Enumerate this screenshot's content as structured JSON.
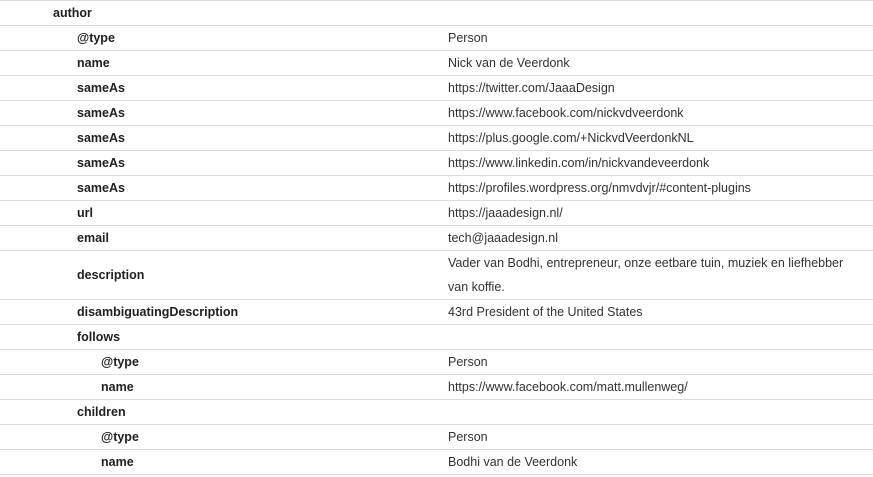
{
  "rows": [
    {
      "key": "author",
      "value": ""
    },
    {
      "key": "@type",
      "value": "Person"
    },
    {
      "key": "name",
      "value": "Nick van de Veerdonk"
    },
    {
      "key": "sameAs",
      "value": "https://twitter.com/JaaaDesign"
    },
    {
      "key": "sameAs",
      "value": "https://www.facebook.com/nickvdveerdonk"
    },
    {
      "key": "sameAs",
      "value": "https://plus.google.com/+NickvdVeerdonkNL"
    },
    {
      "key": "sameAs",
      "value": "https://www.linkedin.com/in/nickvandeveerdonk"
    },
    {
      "key": "sameAs",
      "value": "https://profiles.wordpress.org/nmvdvjr/#content-plugins"
    },
    {
      "key": "url",
      "value": "https://jaaadesign.nl/"
    },
    {
      "key": "email",
      "value": "tech@jaaadesign.nl"
    },
    {
      "key": "description",
      "value": "Vader van Bodhi, entrepreneur, onze eetbare tuin, muziek en liefhebber van koffie."
    },
    {
      "key": "disambiguatingDescription",
      "value": "43rd President of the United States"
    },
    {
      "key": "follows",
      "value": ""
    },
    {
      "key": "@type",
      "value": "Person"
    },
    {
      "key": "name",
      "value": "https://www.facebook.com/matt.mullenweg/"
    },
    {
      "key": "children",
      "value": ""
    },
    {
      "key": "@type",
      "value": "Person"
    },
    {
      "key": "name",
      "value": "Bodhi van de Veerdonk"
    }
  ]
}
